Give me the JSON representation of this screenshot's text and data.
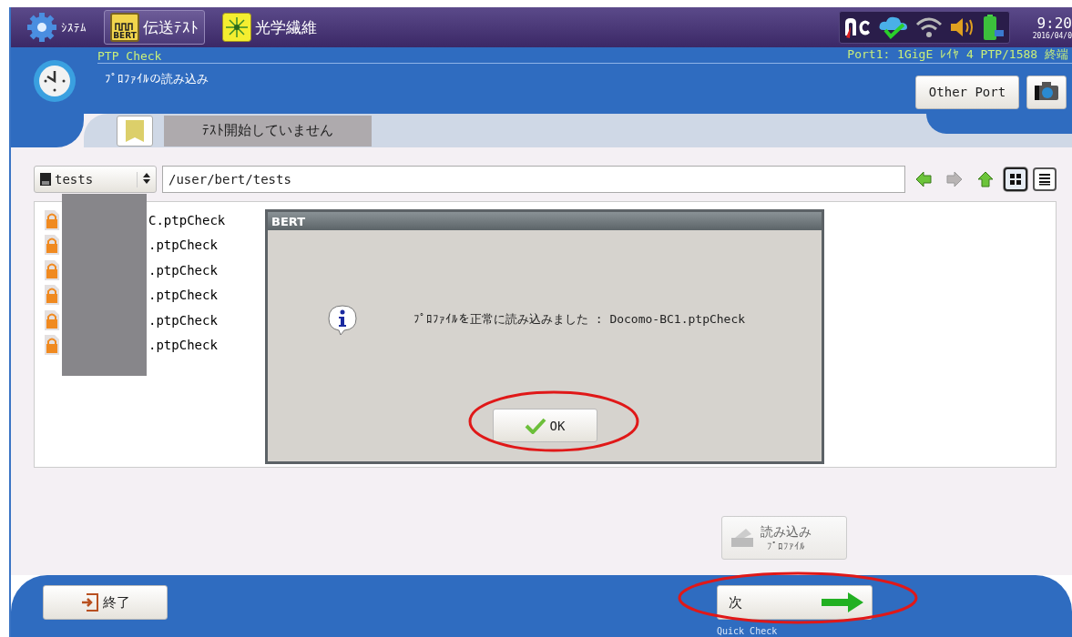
{
  "top_tabs": [
    {
      "kind": "system",
      "label": "ｼｽﾃﾑ",
      "selected": false
    },
    {
      "kind": "bert",
      "label": "伝送ﾃｽﾄ",
      "icon_text": "BERT",
      "selected": true
    },
    {
      "kind": "fiber",
      "label": "光学繊維",
      "selected": false
    }
  ],
  "clock": {
    "time": "9:20",
    "date": "2016/04/0"
  },
  "header": {
    "app": "PTP Check",
    "port": "Port1: 1GigE ﾚｲﾔ 4 PTP/1588 終端",
    "page": "ﾌﾟﾛﾌｧｲﾙの読み込み",
    "other_port": "Other Port",
    "test_status": "ﾃｽﾄ開始していません"
  },
  "browser": {
    "folder": "tests",
    "path": "/user/bert/tests",
    "nav": [
      {
        "kind": "back",
        "disabled": false
      },
      {
        "kind": "forward",
        "disabled": true
      },
      {
        "kind": "up",
        "disabled": false
      }
    ],
    "views": [
      {
        "kind": "grid",
        "selected": true
      },
      {
        "kind": "list",
        "selected": false
      }
    ],
    "files": [
      {
        "name": "C.ptpCheck"
      },
      {
        "name": ".ptpCheck"
      },
      {
        "name": ".ptpCheck"
      },
      {
        "name": ".ptpCheck"
      },
      {
        "name": ".ptpCheck"
      },
      {
        "name": ".ptpCheck"
      }
    ]
  },
  "dialog": {
    "title": "BERT",
    "message": "ﾌﾟﾛﾌｧｲﾙを正常に読み込みました : Docomo-BC1.ptpCheck",
    "ok": "OK"
  },
  "load_button": {
    "line1": "読み込み",
    "line2": "ﾌﾟﾛﾌｧｲﾙ",
    "disabled": true
  },
  "footer": {
    "exit": "終了",
    "next": "次",
    "next_sub": "Quick Check"
  }
}
